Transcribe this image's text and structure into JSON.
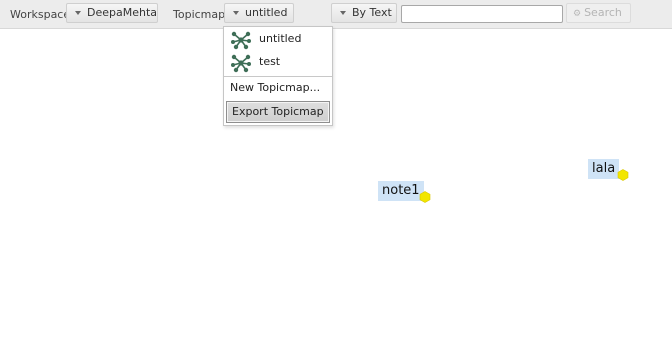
{
  "toolbar": {
    "workspace_label": "Workspace",
    "workspace_value": "DeepaMehta",
    "topicmap_label": "Topicmap",
    "topicmap_value": "untitled",
    "search_mode": "By Text",
    "search_input_value": "",
    "search_button": "Search"
  },
  "topicmap_menu": {
    "items": [
      {
        "label": "untitled",
        "icon": "topicmap-network-icon"
      },
      {
        "label": "test",
        "icon": "topicmap-network-icon"
      }
    ],
    "new_label": "New Topicmap...",
    "export_label": "Export Topicmap"
  },
  "canvas": {
    "topics": [
      {
        "label": "note1"
      },
      {
        "label": "lala"
      }
    ]
  },
  "colors": {
    "topic_highlight": "#cfe3f6",
    "topic_dot": "#f2e600",
    "toolbar_bg": "#ececec",
    "icon_green": "#3e6e57"
  }
}
